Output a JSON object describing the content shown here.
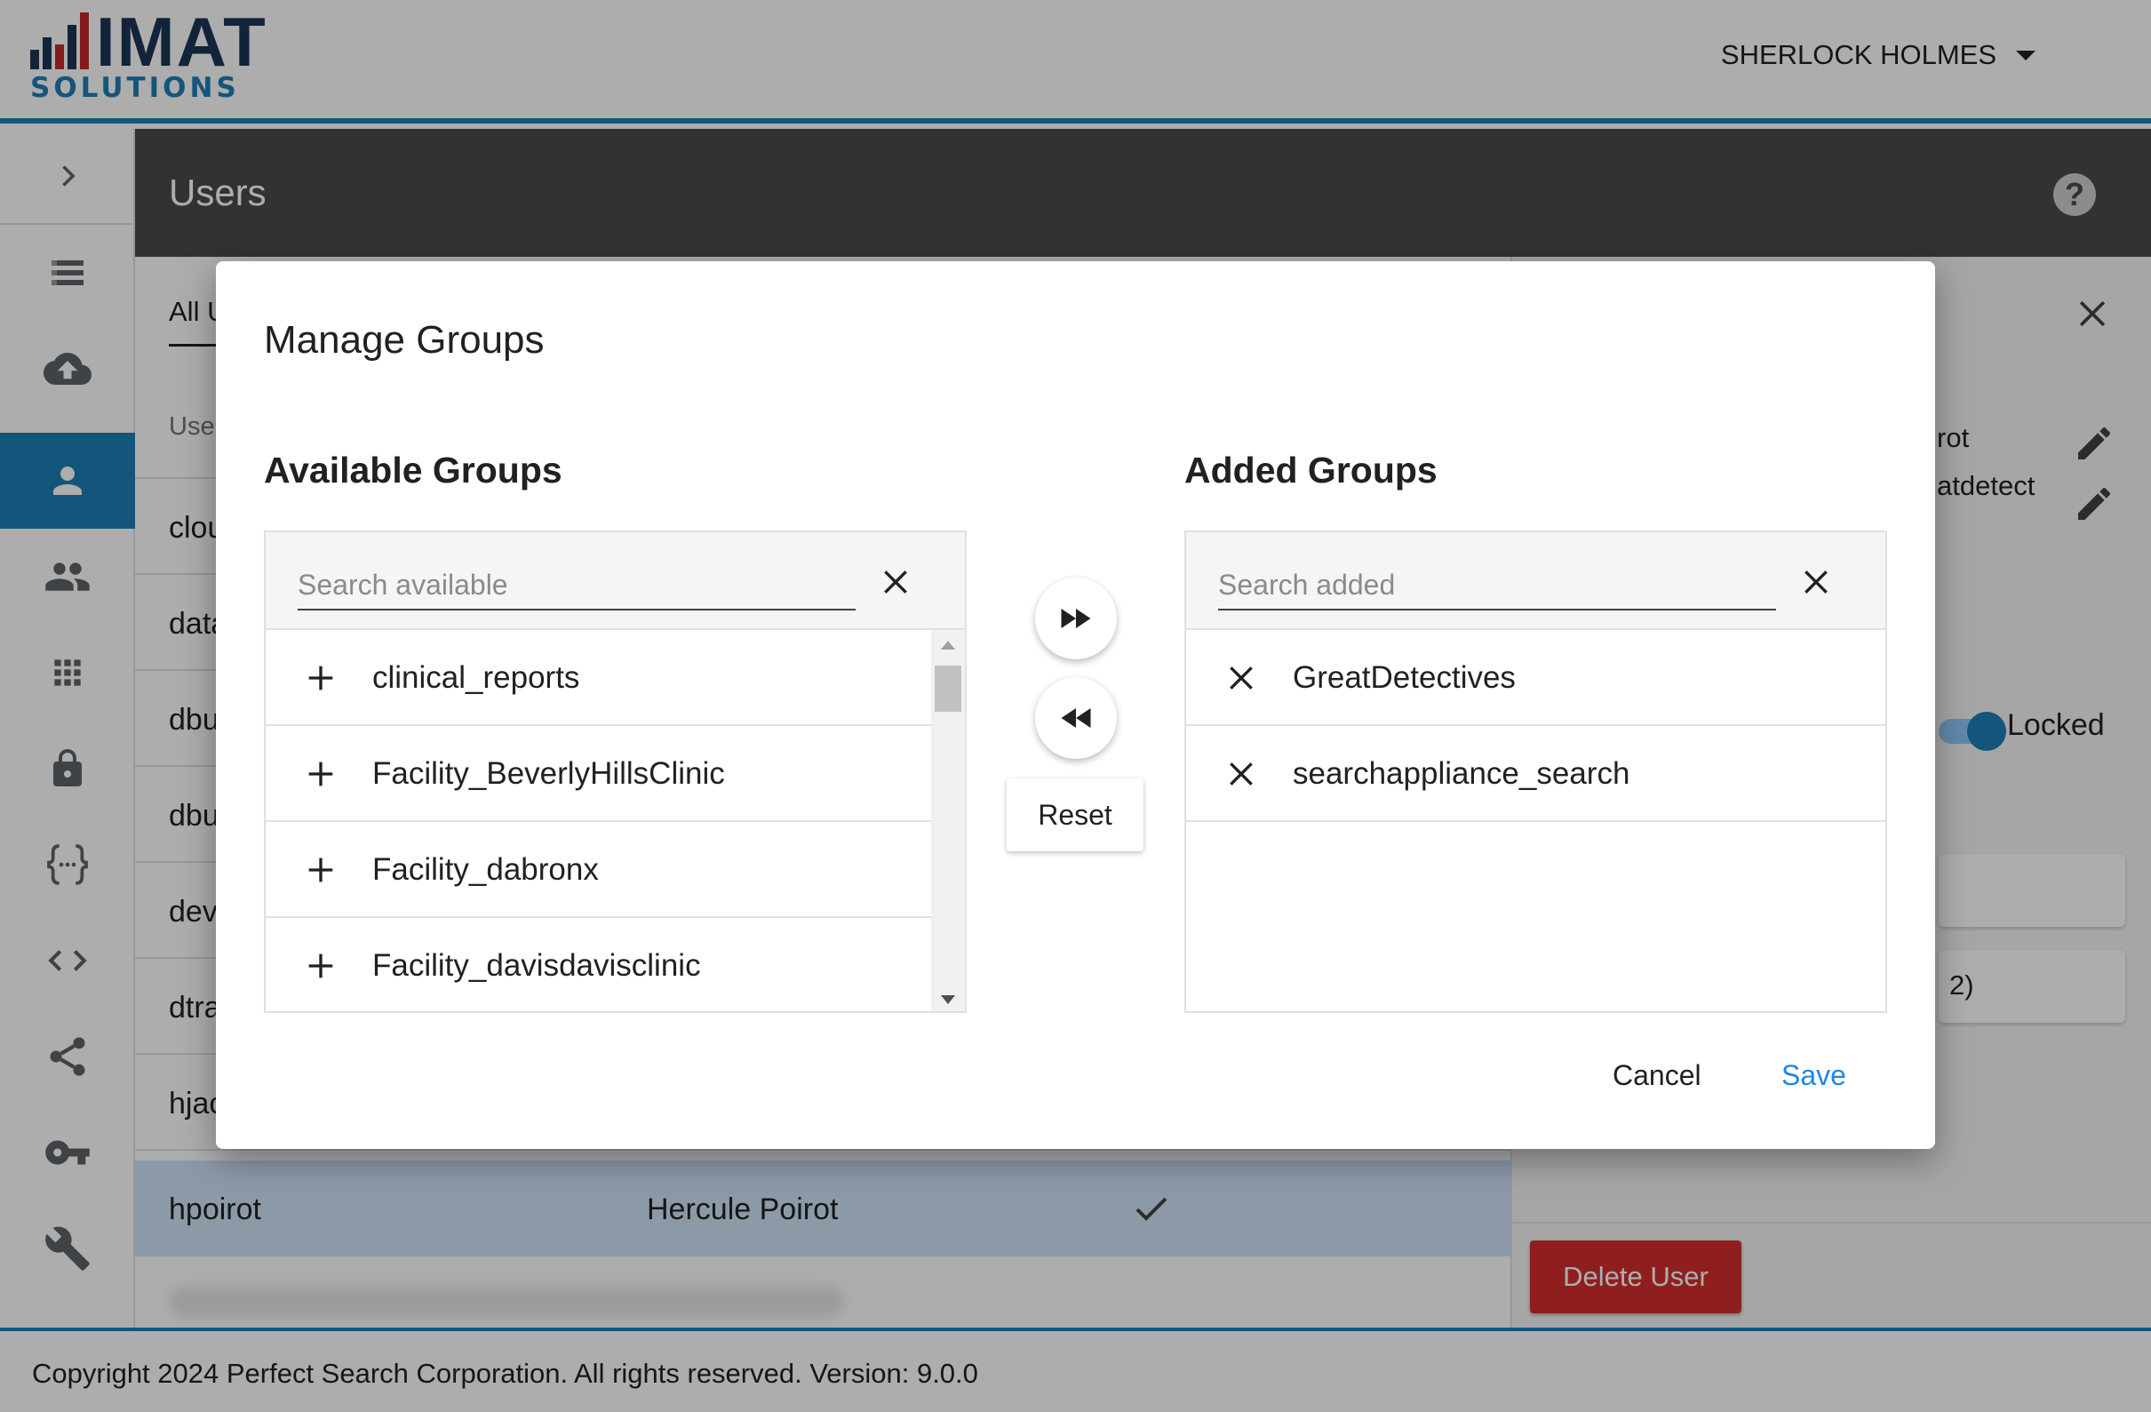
{
  "header": {
    "logo": {
      "word": "IMAT",
      "sub": "SOLUTIONS"
    },
    "user_name": "SHERLOCK HOLMES"
  },
  "sidebar": {
    "items": [
      {
        "icon": "chevron-right-icon"
      },
      {
        "icon": "list-icon"
      },
      {
        "icon": "cloud-upload-icon"
      },
      {
        "icon": "person-icon",
        "active": true
      },
      {
        "icon": "people-icon"
      },
      {
        "icon": "apps-icon"
      },
      {
        "icon": "lock-icon"
      },
      {
        "icon": "braces-icon"
      },
      {
        "icon": "code-icon"
      },
      {
        "icon": "share-icon"
      },
      {
        "icon": "key-icon"
      },
      {
        "icon": "wrench-icon"
      }
    ]
  },
  "page": {
    "title": "Users"
  },
  "users_list": {
    "tab_label": "All U",
    "column_header": "Use",
    "rows": [
      {
        "username": "clou"
      },
      {
        "username": "data"
      },
      {
        "username": "dbu"
      },
      {
        "username": "dbu"
      },
      {
        "username": "dev"
      },
      {
        "username": "dtra"
      },
      {
        "username": "hjac"
      },
      {
        "username": "hpoirot",
        "full_name": "Hercule Poirot",
        "selected": true
      }
    ]
  },
  "detail_panel": {
    "line1": "rot",
    "line2": "atdetect",
    "locked_label": "Locked",
    "card2_text": "2)",
    "delete_button": "Delete User"
  },
  "dialog": {
    "title": "Manage Groups",
    "available": {
      "heading": "Available Groups",
      "search_placeholder": "Search available",
      "items": [
        "clinical_reports",
        "Facility_BeverlyHillsClinic",
        "Facility_dabronx",
        "Facility_davisdavisclinic"
      ]
    },
    "added": {
      "heading": "Added Groups",
      "search_placeholder": "Search added",
      "items": [
        "GreatDetectives",
        "searchappliance_search"
      ]
    },
    "reset_label": "Reset",
    "cancel_label": "Cancel",
    "save_label": "Save"
  },
  "footer": {
    "text": "Copyright 2024 Perfect Search Corporation. All rights reserved. Version: 9.0.0"
  },
  "colors": {
    "brand_blue": "#1e7eb5",
    "brand_navy": "#1b3554",
    "accent_red": "#d32f2f",
    "save_blue": "#1e88e5",
    "header_gray": "#4a4a4a"
  }
}
